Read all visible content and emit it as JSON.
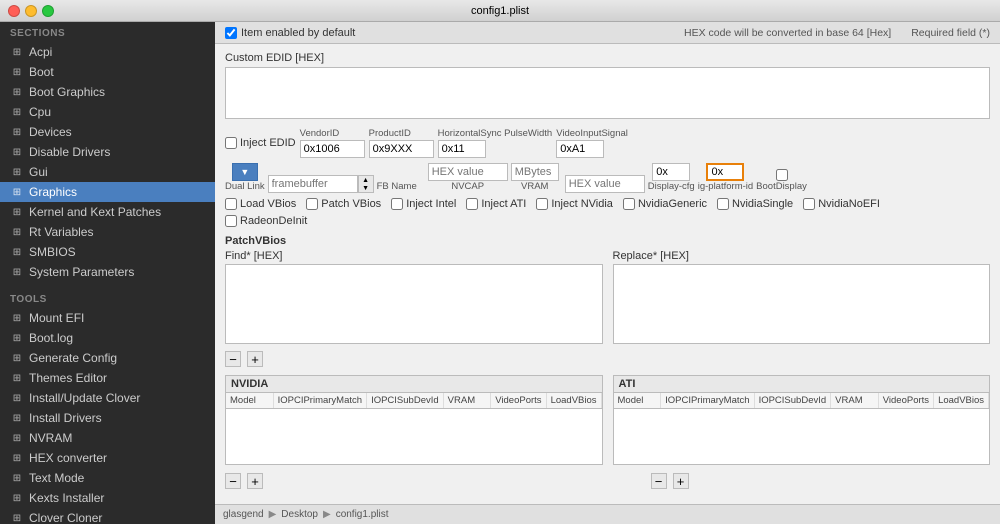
{
  "titlebar": {
    "title": "config1.plist"
  },
  "header": {
    "checkbox_label": "Item enabled by default",
    "note1": "HEX code will be converted in base 64 [Hex]",
    "note2": "Required field (*)"
  },
  "sidebar": {
    "sections_label": "SECTIONS",
    "tools_label": "TOOLS",
    "sections": [
      {
        "id": "acpi",
        "label": "Acpi",
        "icon": "⊞"
      },
      {
        "id": "boot",
        "label": "Boot",
        "icon": "⊞"
      },
      {
        "id": "boot-graphics",
        "label": "Boot Graphics",
        "icon": "⊞"
      },
      {
        "id": "cpu",
        "label": "Cpu",
        "icon": "⊞"
      },
      {
        "id": "devices",
        "label": "Devices",
        "icon": "⊞"
      },
      {
        "id": "disable-drivers",
        "label": "Disable Drivers",
        "icon": "⊞"
      },
      {
        "id": "gui",
        "label": "Gui",
        "icon": "⊞"
      },
      {
        "id": "graphics",
        "label": "Graphics",
        "icon": "⊞",
        "active": true
      },
      {
        "id": "kernel-kext",
        "label": "Kernel and Kext Patches",
        "icon": "⊞"
      },
      {
        "id": "rt-variables",
        "label": "Rt Variables",
        "icon": "⊞"
      },
      {
        "id": "smbios",
        "label": "SMBIOS",
        "icon": "⊞"
      },
      {
        "id": "system-parameters",
        "label": "System Parameters",
        "icon": "⊞"
      }
    ],
    "tools": [
      {
        "id": "mount-efi",
        "label": "Mount EFI",
        "icon": "⊞"
      },
      {
        "id": "boot-log",
        "label": "Boot.log",
        "icon": "⊞"
      },
      {
        "id": "generate-config",
        "label": "Generate Config",
        "icon": "⊞"
      },
      {
        "id": "themes-editor",
        "label": "Themes Editor",
        "icon": "⊞"
      },
      {
        "id": "install-update-clover",
        "label": "Install/Update Clover",
        "icon": "⊞"
      },
      {
        "id": "install-drivers",
        "label": "Install Drivers",
        "icon": "⊞"
      },
      {
        "id": "nvram",
        "label": "NVRAM",
        "icon": "⊞"
      },
      {
        "id": "hex-converter",
        "label": "HEX converter",
        "icon": "⊞"
      },
      {
        "id": "text-mode",
        "label": "Text Mode",
        "icon": "⊞"
      },
      {
        "id": "kexts-installer",
        "label": "Kexts Installer",
        "icon": "⊞"
      },
      {
        "id": "clover-cloner",
        "label": "Clover Cloner",
        "icon": "⊞"
      }
    ]
  },
  "main": {
    "custom_edid_label": "Custom EDID [HEX]",
    "inject_edid_label": "Inject EDID",
    "vendor_id_label": "VendorID",
    "vendor_id_value": "0x1006",
    "product_id_label": "ProductID",
    "product_id_value": "0x9XXX",
    "horiz_sync_label": "HorizontalSync PulseWidth",
    "horiz_sync_value": "0x11",
    "video_input_label": "VideoInputSignal",
    "video_input_value": "0xA1",
    "dual_link_label": "Dual Link",
    "fb_name_label": "FB Name",
    "fb_name_placeholder": "framebuffer",
    "nvcap_label": "NVCAP",
    "nvcap_placeholder": "HEX value",
    "vram_label": "VRAM",
    "vram_placeholder": "MBytes",
    "vram_hex_label": "HEX value",
    "vram_hex_placeholder": "HEX value",
    "display_cfg_label": "Display-cfg",
    "display_cfg_value": "0x",
    "ig_platform_label": "ig-platform-id",
    "ig_platform_value": "0x",
    "boot_display_label": "BootDisplay",
    "load_vbios_label": "Load VBios",
    "patch_vbios_label": "Patch VBios",
    "inject_intel_label": "Inject Intel",
    "inject_ati_label": "Inject ATI",
    "inject_nvidia_label": "Inject NVidia",
    "nvidia_generic_label": "NvidiaGeneric",
    "nvidia_single_label": "NvidiaSingle",
    "nvidia_no_efi_label": "NvidiaNoEFI",
    "radeon_deinit_label": "RadeonDeInit",
    "patch_vbios_section": "PatchVBios",
    "find_hex_label": "Find* [HEX]",
    "replace_hex_label": "Replace* [HEX]",
    "add_btn": "+",
    "remove_btn": "−",
    "nvidia_title": "NVIDIA",
    "ati_title": "ATI",
    "table_cols": [
      "Model",
      "IOPCIPrimaryMatch",
      "IOPCISubDevId",
      "VRAM",
      "VideoPorts",
      "LoadVBios"
    ],
    "statusbar": {
      "path": "glasgend",
      "arrow": "▶",
      "path2": "Desktop",
      "arrow2": "▶",
      "file": "config1.plist"
    }
  }
}
